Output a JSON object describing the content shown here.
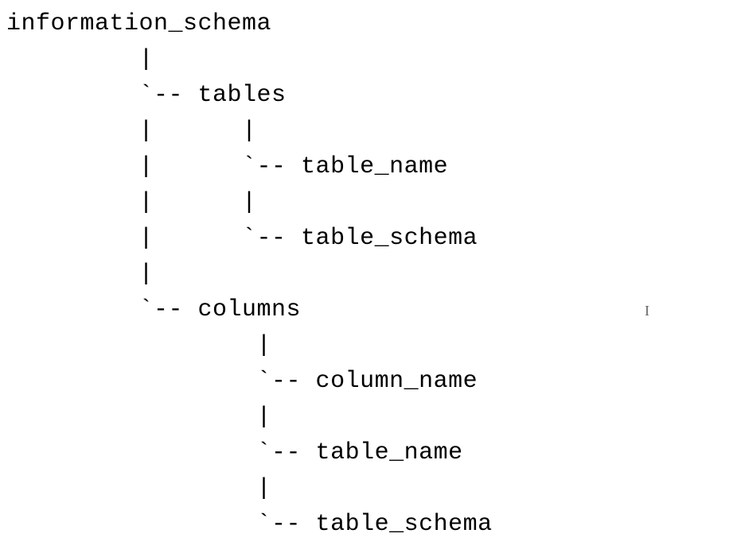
{
  "tree": {
    "root": "information_schema",
    "children": [
      {
        "name": "tables",
        "children": [
          {
            "name": "table_name"
          },
          {
            "name": "table_schema"
          }
        ]
      },
      {
        "name": "columns",
        "children": [
          {
            "name": "column_name"
          },
          {
            "name": "table_name"
          },
          {
            "name": "table_schema"
          }
        ]
      }
    ]
  },
  "rendered_lines": [
    "information_schema",
    "         |",
    "         `-- tables",
    "         |      |",
    "         |      `-- table_name",
    "         |      |",
    "         |      `-- table_schema",
    "         |",
    "         `-- columns",
    "                 |",
    "                 `-- column_name",
    "                 |",
    "                 `-- table_name",
    "                 |",
    "                 `-- table_schema"
  ],
  "cursor_glyph": "I"
}
